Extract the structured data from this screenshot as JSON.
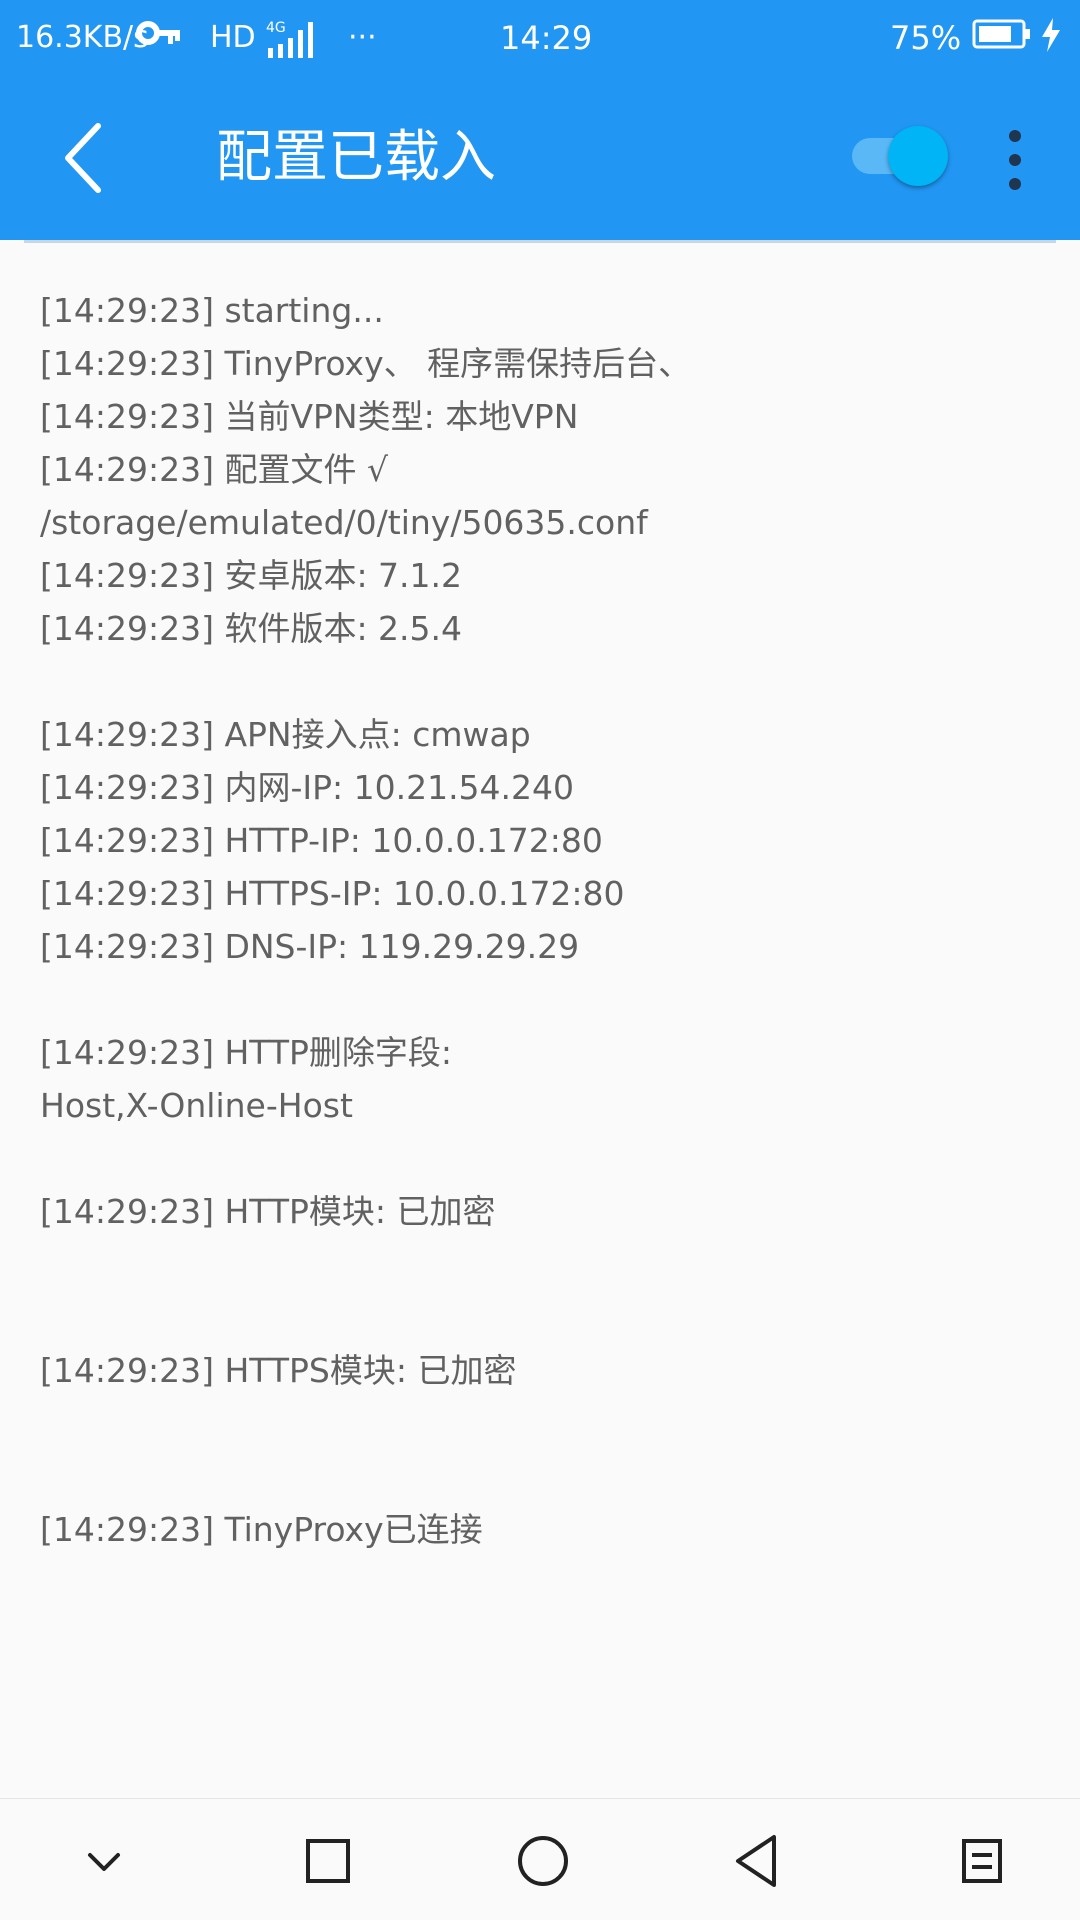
{
  "status_bar": {
    "net_speed": "16.3KB/s",
    "hd_label": "HD",
    "network_type": "4G",
    "more": "···",
    "time": "14:29",
    "battery_percent": "75%",
    "icons": [
      "key-icon",
      "signal-icon",
      "battery-icon",
      "charging-icon"
    ]
  },
  "app_bar": {
    "title": "配置已载入",
    "vpn_toggle_on": true,
    "accent_color": "#2196f3",
    "toggle_color": "#00b4f5"
  },
  "log": {
    "lines": [
      "[14:29:23] starting...",
      "[14:29:23] TinyProxy、 程序需保持后台、",
      "[14:29:23] 当前VPN类型: 本地VPN",
      "[14:29:23] 配置文件 √",
      "/storage/emulated/0/tiny/50635.conf",
      "[14:29:23] 安卓版本: 7.1.2",
      "[14:29:23] 软件版本: 2.5.4",
      "",
      "[14:29:23] APN接入点: cmwap",
      "[14:29:23] 内网-IP: 10.21.54.240",
      "[14:29:23] HTTP-IP: 10.0.0.172:80",
      "[14:29:23] HTTPS-IP: 10.0.0.172:80",
      "[14:29:23] DNS-IP: 119.29.29.29",
      "",
      "[14:29:23] HTTP删除字段:",
      "Host,X-Online-Host",
      "",
      "[14:29:23] HTTP模块: 已加密",
      "",
      "",
      "[14:29:23] HTTPS模块: 已加密",
      "",
      "",
      "[14:29:23] TinyProxy已连接"
    ]
  },
  "nav_bar": {
    "buttons": [
      "chevron-down-icon",
      "square-recents-icon",
      "circle-home-icon",
      "triangle-back-icon",
      "notes-menu-icon"
    ]
  }
}
